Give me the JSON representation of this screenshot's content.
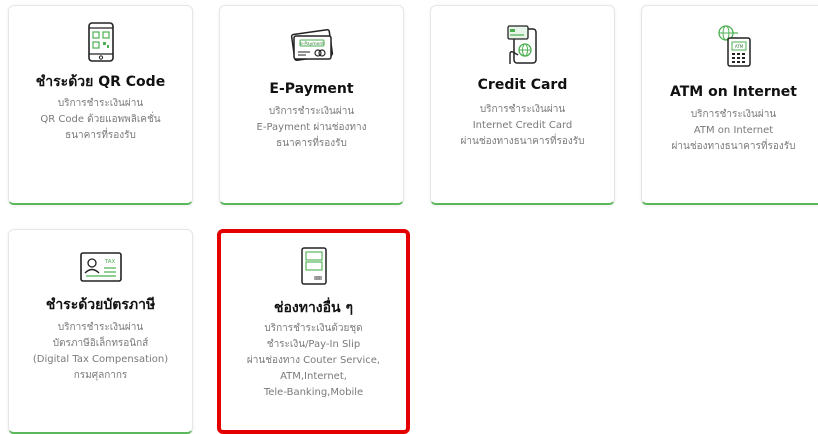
{
  "accent_color": "#5cb85c",
  "selected_border_color": "#e50000",
  "cards": [
    {
      "icon": "qr-phone-icon",
      "title": "ชำระด้วย QR Code",
      "desc": [
        "บริการชำระเงินผ่าน",
        "QR Code ด้วยแอพพลิเคชั่น",
        "ธนาคารที่รองรับ"
      ]
    },
    {
      "icon": "e-payment-card-icon",
      "icon_text": "e-Payment",
      "title": "E-Payment",
      "desc": [
        "บริการชำระเงินผ่าน",
        "E-Payment ผ่านช่องทาง",
        "ธนาคารที่รองรับ"
      ]
    },
    {
      "icon": "credit-card-hand-icon",
      "title": "Credit Card",
      "desc": [
        "บริการชำระเงินผ่าน",
        "Internet Credit Card",
        "ผ่านช่องทางธนาคารที่รองรับ"
      ]
    },
    {
      "icon": "atm-internet-icon",
      "icon_text": "ATM",
      "title": "ATM on Internet",
      "desc": [
        "บริการชำระเงินผ่าน",
        "ATM on Internet",
        "ผ่านช่องทางธนาคารที่รองรับ"
      ]
    },
    {
      "icon": "tax-id-card-icon",
      "icon_text": "TAX",
      "title": "ชำระด้วยบัตรภาษี",
      "desc": [
        "บริการชำระเงินผ่าน",
        "บัตรภาษีอิเล็กทรอนิกส์",
        "(Digital Tax Compensation)",
        "กรมศุลกากร"
      ]
    },
    {
      "icon": "pay-in-slip-icon",
      "title": "ช่องทางอื่น ๆ",
      "selected": true,
      "desc": [
        "บริการชำระเงินด้วยชุด",
        "ชำระเงิน/Pay-In Slip",
        "ผ่านช่องทาง Couter Service,",
        "ATM,Internet,",
        "Tele-Banking,Mobile"
      ]
    }
  ]
}
